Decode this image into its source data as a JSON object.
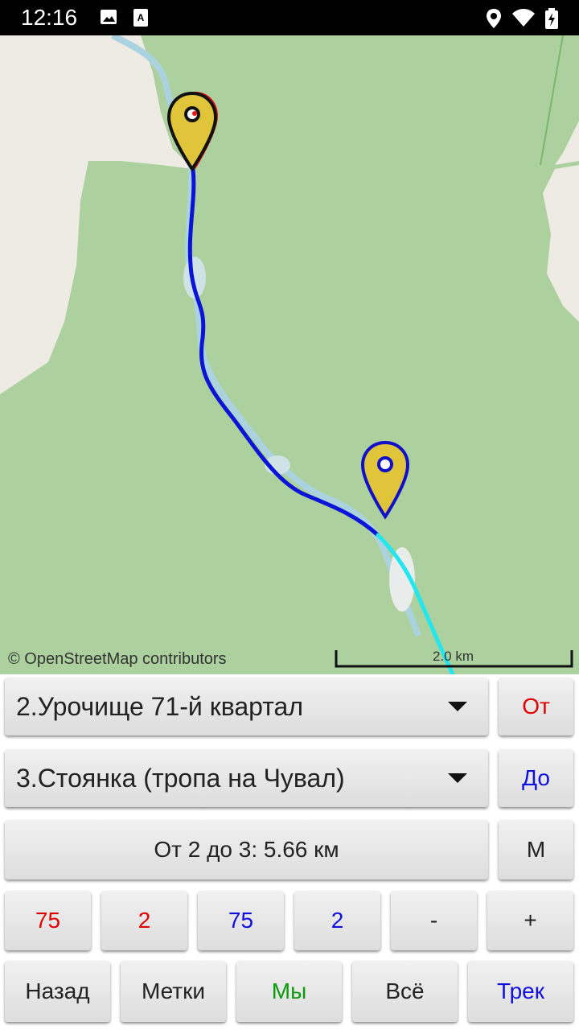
{
  "status_bar": {
    "time": "12:16",
    "icons": [
      "image-icon",
      "keyboard-a-icon",
      "location-icon",
      "wifi-icon",
      "battery-charging-icon"
    ]
  },
  "map": {
    "attribution": "© OpenStreetMap contributors",
    "scale_label": "2.0 km",
    "colors": {
      "forest": "#add19e",
      "land": "#eeeae4",
      "water": "#aad3df",
      "route_done": "#0a14d8",
      "route_next": "#22e6f0",
      "marker_fill": "#e0c43a"
    },
    "markers": [
      {
        "name": "start-marker",
        "outline": "red-black"
      },
      {
        "name": "destination-marker",
        "outline": "blue"
      }
    ]
  },
  "controls": {
    "from_point": {
      "value": "2.Урочище 71-й квартал"
    },
    "to_point": {
      "value": "3.Стоянка (тропа на Чувал)"
    },
    "from_button": "От",
    "to_button": "До",
    "distance": "От 2 до 3: 5.66 км",
    "m_button": "М",
    "row3": {
      "a": "75",
      "b": "2",
      "c": "75",
      "d": "2",
      "minus": "-",
      "plus": "+"
    },
    "nav": {
      "back": "Назад",
      "marks": "Метки",
      "we": "Мы",
      "all": "Всё",
      "track": "Трек"
    }
  }
}
